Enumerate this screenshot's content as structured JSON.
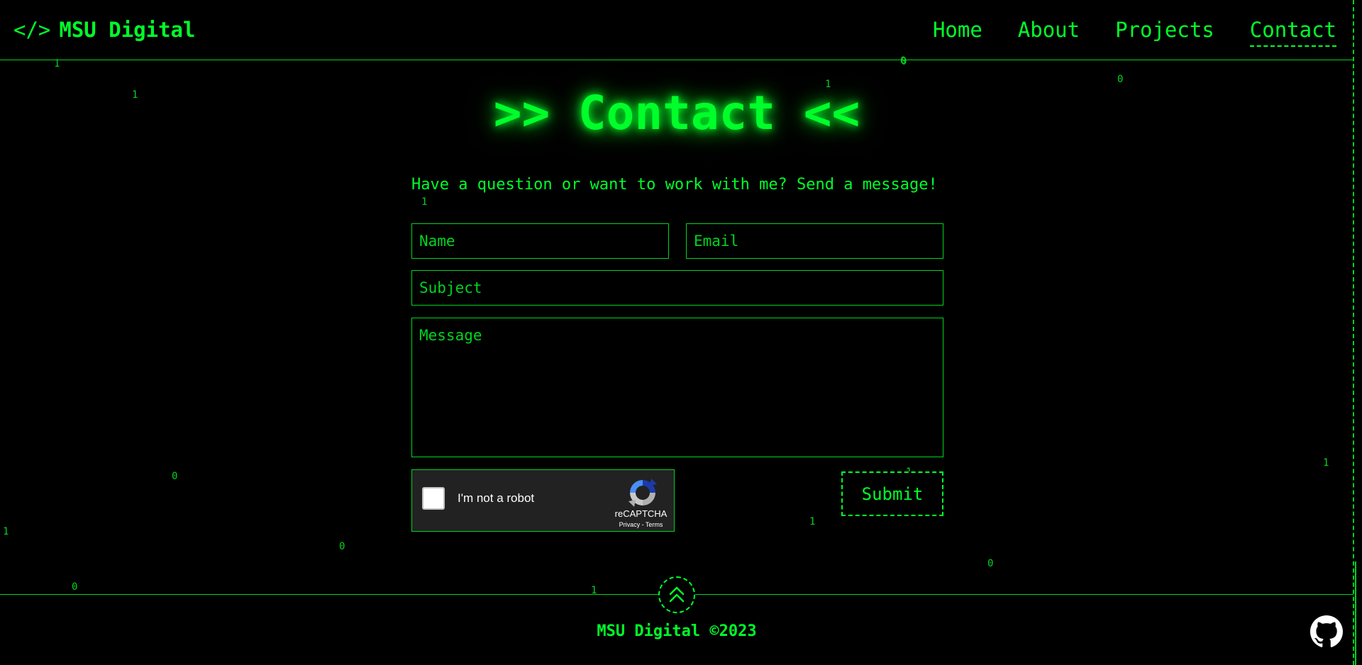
{
  "header": {
    "brand_bracket": "</>",
    "brand_name": "MSU Digital",
    "nav": [
      {
        "label": "Home"
      },
      {
        "label": "About"
      },
      {
        "label": "Projects"
      },
      {
        "label": "Contact",
        "active": true
      }
    ]
  },
  "main": {
    "title": ">> Contact <<",
    "intro": "Have a question or want to work with me? Send a message!",
    "form": {
      "name_placeholder": "Name",
      "email_placeholder": "Email",
      "subject_placeholder": "Subject",
      "message_placeholder": "Message",
      "submit_label": "Submit"
    },
    "recaptcha": {
      "label": "I'm not a robot",
      "brand": "reCAPTCHA",
      "links": "Privacy - Terms",
      "checked": false
    }
  },
  "background_digits": [
    "1",
    "1",
    "0",
    "1",
    "0",
    "1",
    "0",
    "1",
    "0",
    "1",
    "0",
    "1",
    "0",
    "1",
    "1",
    "0"
  ],
  "footer": {
    "text": "MSU Digital ©2023",
    "scroll_top_icon": "double-chevron-up-icon",
    "github_icon": "github-icon"
  },
  "colors": {
    "background": "#000000",
    "accent": "#00ff2a",
    "line": "#00d41f"
  }
}
